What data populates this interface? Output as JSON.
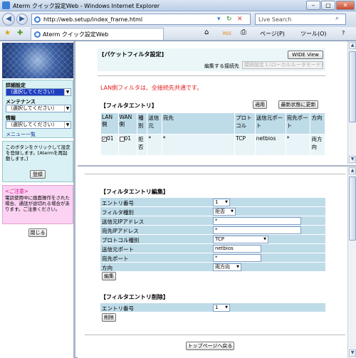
{
  "window": {
    "title": "Aterm クイック設定Web - Windows Internet Explorer",
    "minimize": "–",
    "maximize": "□",
    "close": "✕"
  },
  "address": {
    "url": "http://web.setup/index_frame.html",
    "search_placeholder": "Live Search"
  },
  "tab": {
    "label": "Aterm クイック設定Web"
  },
  "toolbar": {
    "home": "⌂",
    "feeds": "RSS",
    "print": "⎙",
    "page": "ページ(P)",
    "tools": "ツール(O)",
    "help": "?"
  },
  "sidebar": {
    "detail_label": "詳細設定",
    "detail_select": "（選択してください）",
    "maintenance_label": "メンテナンス",
    "maintenance_select": "（選択してください）",
    "info_label": "情報",
    "info_select": "（選択してください）",
    "menu_list_link": "メニュー一覧",
    "register_text": "このボタンをクリックして設定を登録します。[Atermを再起動します。]",
    "register_button": "登録",
    "caution_title": "<ご注意>",
    "caution_text": "電話使用中に画面操作をされた場合、通話が途切れる場合があります。ご注意ください。",
    "close_button": "閉じる"
  },
  "top": {
    "title": "[パケットフィルタ設定]",
    "wide_view": "WIDE View",
    "connection_label": "編集する接続先",
    "connection_value": "接続設定１(ローカルルータモード)",
    "notice": "LAN側フィルタは、全接続先共通です。",
    "entries_title": "【フィルタエントリ】",
    "apply_button": "適用",
    "refresh_button": "最新状態に更新",
    "columns": [
      "LAN側",
      "WAN側",
      "種別",
      "送信元",
      "宛先",
      "プロトコル",
      "送信元ポート",
      "宛先ポート",
      "方向"
    ],
    "row": {
      "lan": "01",
      "wan": "01",
      "type": "拒否",
      "src": "*",
      "dst": "*",
      "protocol": "TCP",
      "src_port": "netbios",
      "dst_port": "*",
      "direction": "両方向"
    }
  },
  "edit": {
    "title": "【フィルタエントリ編集】",
    "entry_label": "エントリ番号",
    "entry_value": "1",
    "kind_label": "フィルタ種別",
    "kind_value": "拒否",
    "src_ip_label": "送信元IPアドレス",
    "src_ip_value": "*",
    "dst_ip_label": "宛先IPアドレス",
    "dst_ip_value": "*",
    "protocol_label": "プロトコル種別",
    "protocol_value": "TCP",
    "src_port_label": "送信元ポート",
    "src_port_value": "netbios",
    "dst_port_label": "宛先ポート",
    "dst_port_value": "*",
    "direction_label": "方向",
    "direction_value": "両方向",
    "edit_button": "編集",
    "delete_title": "【フィルタエントリ削除】",
    "delete_entry_label": "エントリ番号",
    "delete_entry_value": "1",
    "delete_button": "削除",
    "back_button": "トップページへ戻る"
  }
}
